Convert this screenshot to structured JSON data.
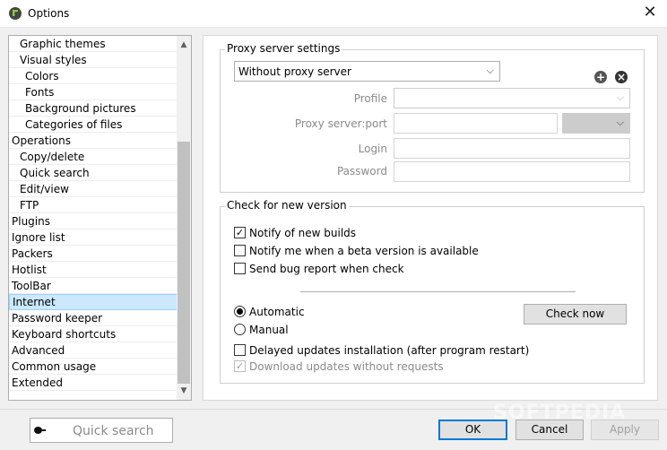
{
  "window": {
    "title": "Options",
    "close_glyph": "✕"
  },
  "nav": {
    "items": [
      {
        "label": "Graphic themes",
        "level": 1
      },
      {
        "label": "Visual styles",
        "level": 1
      },
      {
        "label": "Colors",
        "level": 2
      },
      {
        "label": "Fonts",
        "level": 2
      },
      {
        "label": "Background pictures",
        "level": 2
      },
      {
        "label": "Categories of files",
        "level": 2
      },
      {
        "label": "Operations",
        "level": 0
      },
      {
        "label": "Copy/delete",
        "level": 1
      },
      {
        "label": "Quick search",
        "level": 1
      },
      {
        "label": "Edit/view",
        "level": 1
      },
      {
        "label": "FTP",
        "level": 1
      },
      {
        "label": "Plugins",
        "level": 0
      },
      {
        "label": "Ignore list",
        "level": 0
      },
      {
        "label": "Packers",
        "level": 0
      },
      {
        "label": "Hotlist",
        "level": 0
      },
      {
        "label": "ToolBar",
        "level": 0
      },
      {
        "label": "Internet",
        "level": 0,
        "selected": true
      },
      {
        "label": "Password keeper",
        "level": 0
      },
      {
        "label": "Keyboard shortcuts",
        "level": 0
      },
      {
        "label": "Advanced",
        "level": 0
      },
      {
        "label": "Common usage",
        "level": 0
      },
      {
        "label": "Extended",
        "level": 0
      }
    ],
    "scroll_up_glyph": "▲",
    "scroll_down_glyph": "▼"
  },
  "proxy": {
    "group_title": "Proxy server settings",
    "mode_value": "Without proxy server",
    "add_glyph": "+",
    "remove_glyph": "×",
    "profile_label": "Profile",
    "server_label": "Proxy server:port",
    "login_label": "Login",
    "password_label": "Password"
  },
  "update": {
    "group_title": "Check for new version",
    "notify_builds": {
      "label": "Notify of new builds",
      "checked": true
    },
    "notify_beta": {
      "label": "Notify me when a beta version is available",
      "checked": false
    },
    "bug_report": {
      "label": "Send bug report when check",
      "checked": false
    },
    "automatic": {
      "label": "Automatic",
      "selected": true
    },
    "manual": {
      "label": "Manual",
      "selected": false
    },
    "check_now_label": "Check now",
    "delayed": {
      "label": "Delayed updates installation (after program restart)",
      "checked": false
    },
    "download_no_request": {
      "label": "Download updates without requests",
      "checked": true,
      "disabled": true
    }
  },
  "footer": {
    "quick_search_placeholder": "Quick search",
    "ok_label": "OK",
    "cancel_label": "Cancel",
    "apply_label": "Apply"
  },
  "watermark": "SOFTPEDIA",
  "colors": {
    "selected_bg": "#cce8ff",
    "accent": "#0078d7",
    "disabled_text": "#8a8a8a"
  }
}
